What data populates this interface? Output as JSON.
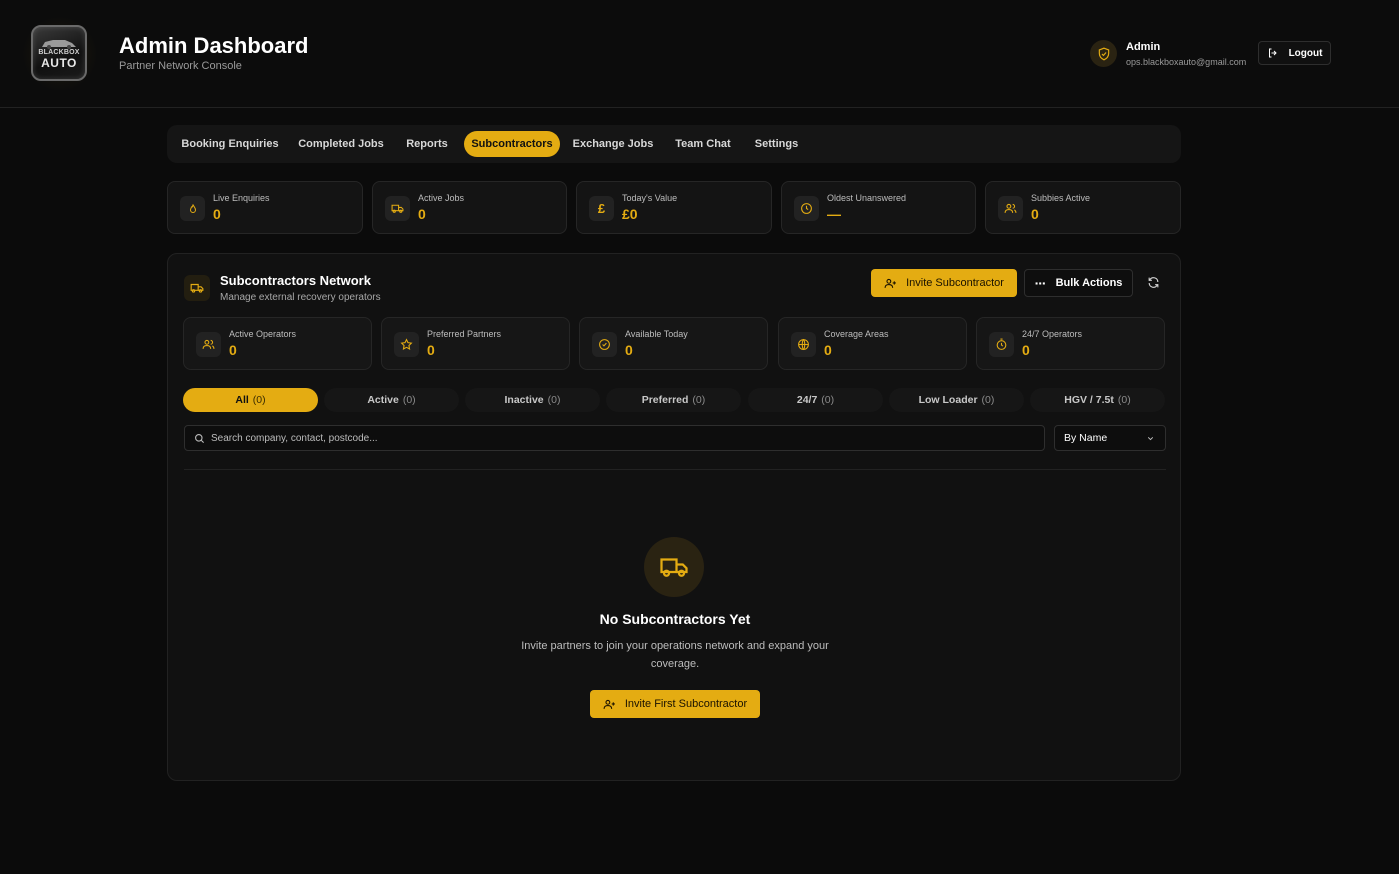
{
  "header": {
    "logo_line1": "BLACKBOX",
    "logo_line2": "AUTO",
    "title": "Admin Dashboard",
    "subtitle": "Partner Network Console",
    "user_name": "Admin",
    "user_email": "ops.blackboxauto@gmail.com",
    "logout_label": "Logout"
  },
  "nav": {
    "tabs": [
      {
        "label": "Booking Enquiries"
      },
      {
        "label": "Completed Jobs"
      },
      {
        "label": "Reports"
      },
      {
        "label": "Subcontractors"
      },
      {
        "label": "Exchange Jobs"
      },
      {
        "label": "Team Chat"
      },
      {
        "label": "Settings"
      }
    ],
    "active": "Subcontractors"
  },
  "stats": [
    {
      "label": "Live Enquiries",
      "value": "0",
      "icon": "flame-icon"
    },
    {
      "label": "Active Jobs",
      "value": "0",
      "icon": "truck-icon"
    },
    {
      "label": "Today's Value",
      "value": "£0",
      "icon": "pound-icon"
    },
    {
      "label": "Oldest Unanswered",
      "value": "—",
      "icon": "clock-icon"
    },
    {
      "label": "Subbies Active",
      "value": "0",
      "icon": "users-icon"
    }
  ],
  "panel": {
    "title": "Subcontractors Network",
    "subtitle": "Manage external recovery operators",
    "invite_label": "Invite Subcontractor",
    "bulk_label": "Bulk Actions",
    "sub_stats": [
      {
        "label": "Active Operators",
        "value": "0",
        "icon": "users-icon"
      },
      {
        "label": "Preferred Partners",
        "value": "0",
        "icon": "star-icon"
      },
      {
        "label": "Available Today",
        "value": "0",
        "icon": "check-circle-icon"
      },
      {
        "label": "Coverage Areas",
        "value": "0",
        "icon": "globe-icon"
      },
      {
        "label": "24/7 Operators",
        "value": "0",
        "icon": "timer-icon"
      }
    ],
    "filters": [
      {
        "label": "All",
        "count": "(0)"
      },
      {
        "label": "Active",
        "count": "(0)"
      },
      {
        "label": "Inactive",
        "count": "(0)"
      },
      {
        "label": "Preferred",
        "count": "(0)"
      },
      {
        "label": "24/7",
        "count": "(0)"
      },
      {
        "label": "Low Loader",
        "count": "(0)"
      },
      {
        "label": "HGV / 7.5t",
        "count": "(0)"
      }
    ],
    "active_filter": "All",
    "search_placeholder": "Search company, contact, postcode...",
    "search_value": "",
    "sort_value": "By Name",
    "empty": {
      "title": "No Subcontractors Yet",
      "description": "Invite partners to join your operations network and expand your coverage.",
      "button_label": "Invite First Subcontractor"
    }
  },
  "colors": {
    "accent": "#e4ac12",
    "background": "#0b0b0b",
    "panel": "#111111"
  }
}
